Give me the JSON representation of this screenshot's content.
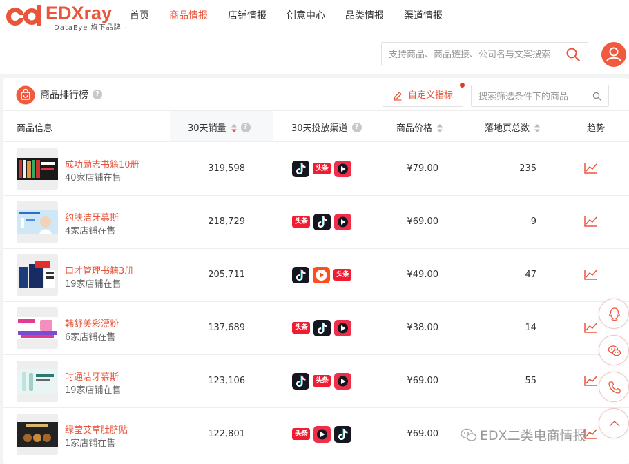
{
  "brand": {
    "name": "EDXray",
    "tagline": "– DataEye 旗下品牌 –",
    "color": "#e9553b"
  },
  "nav": [
    {
      "label": "首页",
      "active": false
    },
    {
      "label": "商品情报",
      "active": true
    },
    {
      "label": "店铺情报",
      "active": false
    },
    {
      "label": "创意中心",
      "active": false
    },
    {
      "label": "品类情报",
      "active": false
    },
    {
      "label": "渠道情报",
      "active": false
    }
  ],
  "search": {
    "placeholder": "支持商品、商品链接、公司名与文案搜索",
    "value": ""
  },
  "panel": {
    "title": "商品排行榜",
    "custom_metric_label": "自定义指标",
    "filter_placeholder": "搜索筛选条件下的商品"
  },
  "columns": [
    {
      "label": "商品信息"
    },
    {
      "label": "30天销量",
      "sort": "desc-active"
    },
    {
      "label": "30天投放渠道"
    },
    {
      "label": "商品价格",
      "sort": "none"
    },
    {
      "label": "落地页总数",
      "sort": "none"
    },
    {
      "label": "趋势"
    }
  ],
  "rows": [
    {
      "name": "成功励志书籍10册",
      "shops": "40家店铺在售",
      "sales": "319,598",
      "channels": [
        "douyin-icon",
        "toutiao-icon",
        "xigua-icon"
      ],
      "price": "¥79.00",
      "pages": "235"
    },
    {
      "name": "约肤洁牙慕斯",
      "shops": "4家店铺在售",
      "sales": "218,729",
      "channels": [
        "toutiao-icon",
        "douyin-icon",
        "xigua-icon"
      ],
      "price": "¥69.00",
      "pages": "9"
    },
    {
      "name": "口才管理书籍3册",
      "shops": "19家店铺在售",
      "sales": "205,711",
      "channels": [
        "douyin-icon",
        "xiaochang-icon",
        "toutiao-icon"
      ],
      "price": "¥49.00",
      "pages": "47"
    },
    {
      "name": "韩舒美彩漂粉",
      "shops": "6家店铺在售",
      "sales": "137,689",
      "channels": [
        "toutiao-icon",
        "douyin-icon",
        "xigua-icon"
      ],
      "price": "¥38.00",
      "pages": "14"
    },
    {
      "name": "时通洁牙慕斯",
      "shops": "19家店铺在售",
      "sales": "123,106",
      "channels": [
        "douyin-icon",
        "toutiao-icon",
        "xigua-icon"
      ],
      "price": "¥69.00",
      "pages": "55"
    },
    {
      "name": "绿莹艾草肚脐贴",
      "shops": "1家店铺在售",
      "sales": "122,801",
      "channels": [
        "toutiao-icon",
        "xigua-icon",
        "douyin-icon"
      ],
      "price": "¥69.00",
      "pages": ""
    }
  ],
  "channel_labels": {
    "toutiao": "头条"
  },
  "float_buttons": [
    "qq-icon",
    "wechat-icon",
    "phone-icon",
    "back-to-top-icon"
  ],
  "watermark": "EDX二类电商情报"
}
